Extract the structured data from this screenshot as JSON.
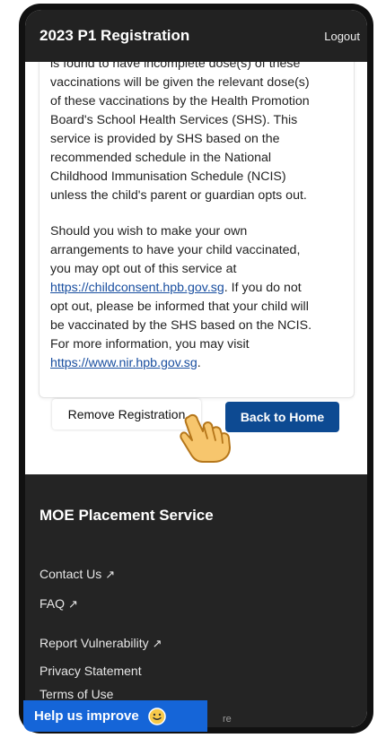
{
  "header": {
    "title": "2023 P1 Registration",
    "logout_label": "Logout"
  },
  "notice": {
    "paragraph1_lines": [
      "is found to have incomplete dose(s) of these",
      "vaccinations will be given the relevant dose(s)",
      "of these vaccinations by the Health Promotion",
      "Board's School Health Services (SHS). This",
      "service is provided by SHS based on the",
      "recommended schedule in the National",
      "Childhood Immunisation Schedule (NCIS)",
      "unless the child's parent or guardian opts out."
    ],
    "p2_line1": "Should you wish to make your own",
    "p2_line2": "arrangements to have your child vaccinated,",
    "p2_line3": "you may opt out of this service at",
    "p2_link1": "https://childconsent.hpb.gov.sg",
    "p2_line4_rest": ". If you do not",
    "p2_line5": "opt out, please be informed that your child will",
    "p2_line6": "be vaccinated by the SHS based on the NCIS.",
    "p2_line7": "For more information, you may visit",
    "p2_link2": "https://www.nir.hpb.gov.sg",
    "p2_tail": "."
  },
  "actions": {
    "remove_label": "Remove Registration",
    "home_label": "Back to Home"
  },
  "footer": {
    "brand": "MOE Placement Service",
    "links": [
      {
        "label": "Contact Us",
        "icon": "external-link-icon"
      },
      {
        "label": "FAQ",
        "icon": "external-link-icon"
      },
      {
        "label": "Report Vulnerability",
        "icon": "external-link-icon"
      },
      {
        "label": "Privacy Statement"
      },
      {
        "label": "Terms of Use"
      }
    ],
    "partial_text": "re"
  },
  "feedback": {
    "label": "Help us improve",
    "icon": "smiley-icon"
  },
  "colors": {
    "header_bg": "#222222",
    "primary": "#0d4a92",
    "feedback_bg": "#1565d8",
    "footer_bg": "#242424",
    "link": "#1a4fa0"
  }
}
